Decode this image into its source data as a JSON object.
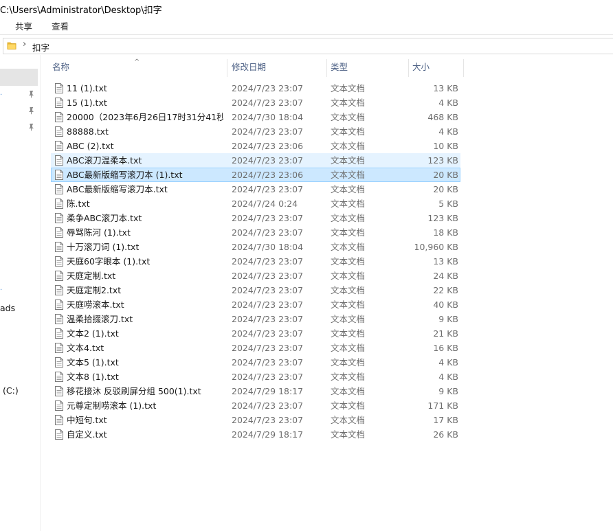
{
  "window": {
    "path": "C:\\Users\\Administrator\\Desktop\\扣字"
  },
  "ribbon": {
    "tabs": [
      "共享",
      "查看"
    ]
  },
  "address": {
    "crumb": "扣字",
    "chevron": "›"
  },
  "nav": {
    "labels": [
      {
        "text": "ads"
      },
      {
        "text": "(C:)"
      }
    ]
  },
  "columns": {
    "name": "名称",
    "date": "修改日期",
    "type": "类型",
    "size": "大小",
    "sort_caret": "^"
  },
  "files": [
    {
      "name": "11 (1).txt",
      "date": "2024/7/23 23:07",
      "type": "文本文档",
      "size": "13 KB",
      "state": ""
    },
    {
      "name": "15 (1).txt",
      "date": "2024/7/23 23:07",
      "type": "文本文档",
      "size": "4 KB",
      "state": ""
    },
    {
      "name": "20000（2023年6月26日17时31分41秒...",
      "date": "2024/7/30 18:04",
      "type": "文本文档",
      "size": "468 KB",
      "state": ""
    },
    {
      "name": "88888.txt",
      "date": "2024/7/23 23:07",
      "type": "文本文档",
      "size": "4 KB",
      "state": ""
    },
    {
      "name": "ABC (2).txt",
      "date": "2024/7/23 23:06",
      "type": "文本文档",
      "size": "10 KB",
      "state": ""
    },
    {
      "name": "ABC滚刀温柔本.txt",
      "date": "2024/7/23 23:07",
      "type": "文本文档",
      "size": "123 KB",
      "state": "hover"
    },
    {
      "name": "ABC最新版缩写滚刀本 (1).txt",
      "date": "2024/7/23 23:06",
      "type": "文本文档",
      "size": "20 KB",
      "state": "selected"
    },
    {
      "name": "ABC最新版缩写滚刀本.txt",
      "date": "2024/7/23 23:07",
      "type": "文本文档",
      "size": "20 KB",
      "state": ""
    },
    {
      "name": "陈.txt",
      "date": "2024/7/24 0:24",
      "type": "文本文档",
      "size": "5 KB",
      "state": ""
    },
    {
      "name": "柔争ABC滚刀本.txt",
      "date": "2024/7/23 23:07",
      "type": "文本文档",
      "size": "123 KB",
      "state": ""
    },
    {
      "name": "辱骂陈河 (1).txt",
      "date": "2024/7/23 23:07",
      "type": "文本文档",
      "size": "18 KB",
      "state": ""
    },
    {
      "name": "十万滚刀词 (1).txt",
      "date": "2024/7/30 18:04",
      "type": "文本文档",
      "size": "10,960 KB",
      "state": ""
    },
    {
      "name": "天庭60字眼本 (1).txt",
      "date": "2024/7/23 23:07",
      "type": "文本文档",
      "size": "13 KB",
      "state": ""
    },
    {
      "name": "天庭定制.txt",
      "date": "2024/7/23 23:07",
      "type": "文本文档",
      "size": "24 KB",
      "state": ""
    },
    {
      "name": "天庭定制2.txt",
      "date": "2024/7/23 23:07",
      "type": "文本文档",
      "size": "22 KB",
      "state": ""
    },
    {
      "name": "天庭唠滚本.txt",
      "date": "2024/7/23 23:07",
      "type": "文本文档",
      "size": "40 KB",
      "state": ""
    },
    {
      "name": "温柔拾掇滚刀.txt",
      "date": "2024/7/23 23:07",
      "type": "文本文档",
      "size": "9 KB",
      "state": ""
    },
    {
      "name": "文本2 (1).txt",
      "date": "2024/7/23 23:07",
      "type": "文本文档",
      "size": "21 KB",
      "state": ""
    },
    {
      "name": "文本4.txt",
      "date": "2024/7/23 23:07",
      "type": "文本文档",
      "size": "16 KB",
      "state": ""
    },
    {
      "name": "文本5 (1).txt",
      "date": "2024/7/23 23:07",
      "type": "文本文档",
      "size": "4 KB",
      "state": ""
    },
    {
      "name": "文本8 (1).txt",
      "date": "2024/7/23 23:07",
      "type": "文本文档",
      "size": "4 KB",
      "state": ""
    },
    {
      "name": "移花接沐 反驳刷屏分组 500(1).txt",
      "date": "2024/7/29 18:17",
      "type": "文本文档",
      "size": "9 KB",
      "state": ""
    },
    {
      "name": "元尊定制唠滚本 (1).txt",
      "date": "2024/7/23 23:07",
      "type": "文本文档",
      "size": "171 KB",
      "state": ""
    },
    {
      "name": "中短句.txt",
      "date": "2024/7/23 23:07",
      "type": "文本文档",
      "size": "17 KB",
      "state": ""
    },
    {
      "name": "自定义.txt",
      "date": "2024/7/29 18:17",
      "type": "文本文档",
      "size": "26 KB",
      "state": ""
    }
  ]
}
